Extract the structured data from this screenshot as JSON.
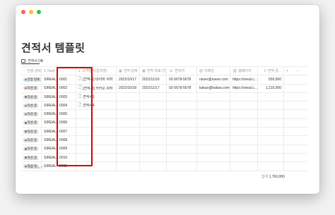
{
  "window": {
    "controls": [
      "close",
      "minimize",
      "maximize"
    ],
    "colors": {
      "close": "#ff5f57",
      "minimize": "#febc2e",
      "maximize": "#28c840"
    }
  },
  "page": {
    "title": "견적서 템플릿"
  },
  "database": {
    "tab_label": "견적서 DB"
  },
  "table": {
    "headers": [
      {
        "key": "status",
        "label": "진행 상태",
        "icon": "status-icon"
      },
      {
        "key": "num",
        "label": "Num",
        "icon": "sigma-icon"
      },
      {
        "key": "client",
        "label": "고객명(사업자명)",
        "icon": "text-icon"
      },
      {
        "key": "date",
        "label": "견적 날짜",
        "icon": "calendar-icon"
      },
      {
        "key": "due",
        "label": "견적 유효기간",
        "icon": "calendar-icon"
      },
      {
        "key": "phone",
        "label": "연락처",
        "icon": "phone-icon"
      },
      {
        "key": "email",
        "label": "이메일",
        "icon": "at-icon"
      },
      {
        "key": "web",
        "label": "홈페이지",
        "icon": "link-icon"
      },
      {
        "key": "amt",
        "label": "견적 금...",
        "icon": "number-icon"
      }
    ],
    "add_column": "+",
    "more": "⋯",
    "rows": [
      {
        "status": "전달 완료",
        "status_color": "#d3e5ef",
        "status_dot": "#4a8fbf",
        "num": "SIREAL - 0001",
        "client": "[견적서] 네이버 귀하",
        "date": "2022/10/17",
        "due": "2022/11/16",
        "phone": "02-5678-5678",
        "email": "naver@naver.com",
        "web": "https://sireal.c...",
        "amt": "550,000"
      },
      {
        "status": "작성 중",
        "status_color": "#e3e2e0",
        "status_dot": "#787774",
        "num": "SIREAL - 0002",
        "client": "[견적서] 카카오 귀하",
        "date": "2022/10/18",
        "due": "2022/11/17",
        "phone": "02-5678-5678",
        "email": "kakao@kakao.com",
        "web": "https://sireal.c...",
        "amt": "1,210,000"
      },
      {
        "status": "작성 중",
        "status_color": "#e3e2e0",
        "status_dot": "#787774",
        "num": "SIREAL - 0003",
        "client": "견적서3",
        "date": "",
        "due": "",
        "phone": "",
        "email": "",
        "web": "",
        "amt": ""
      },
      {
        "status": "작성 중",
        "status_color": "#e3e2e0",
        "status_dot": "#787774",
        "num": "SIREAL - 0004",
        "client": "견적서4",
        "date": "",
        "due": "",
        "phone": "",
        "email": "",
        "web": "",
        "amt": ""
      },
      {
        "status": "작성 중",
        "status_color": "#e3e2e0",
        "status_dot": "#787774",
        "num": "SIREAL - 0005",
        "client": "",
        "date": "",
        "due": "",
        "phone": "",
        "email": "",
        "web": "",
        "amt": ""
      },
      {
        "status": "작성 중",
        "status_color": "#e3e2e0",
        "status_dot": "#787774",
        "num": "SIREAL - 0006",
        "client": "",
        "date": "",
        "due": "",
        "phone": "",
        "email": "",
        "web": "",
        "amt": ""
      },
      {
        "status": "작성 중",
        "status_color": "#e3e2e0",
        "status_dot": "#787774",
        "num": "SIREAL - 0007",
        "client": "",
        "date": "",
        "due": "",
        "phone": "",
        "email": "",
        "web": "",
        "amt": ""
      },
      {
        "status": "작성 중",
        "status_color": "#e3e2e0",
        "status_dot": "#787774",
        "num": "SIREAL - 0008",
        "client": "",
        "date": "",
        "due": "",
        "phone": "",
        "email": "",
        "web": "",
        "amt": ""
      },
      {
        "status": "작성 중",
        "status_color": "#e3e2e0",
        "status_dot": "#787774",
        "num": "SIREAL - 0009",
        "client": "",
        "date": "",
        "due": "",
        "phone": "",
        "email": "",
        "web": "",
        "amt": ""
      },
      {
        "status": "작성 중",
        "status_color": "#e3e2e0",
        "status_dot": "#787774",
        "num": "SIREAL - 0010",
        "client": "",
        "date": "",
        "due": "",
        "phone": "",
        "email": "",
        "web": "",
        "amt": ""
      },
      {
        "status": "작성 중",
        "status_color": "#e3e2e0",
        "status_dot": "#787774",
        "num": "SIREAL - 0011",
        "client": "",
        "date": "",
        "due": "",
        "phone": "",
        "email": "",
        "web": "",
        "amt": ""
      }
    ],
    "new_row_label": "+ 새로 만들기",
    "sum_label": "합계",
    "sum_value": "1,760,000"
  },
  "highlight_color": "#d60000"
}
